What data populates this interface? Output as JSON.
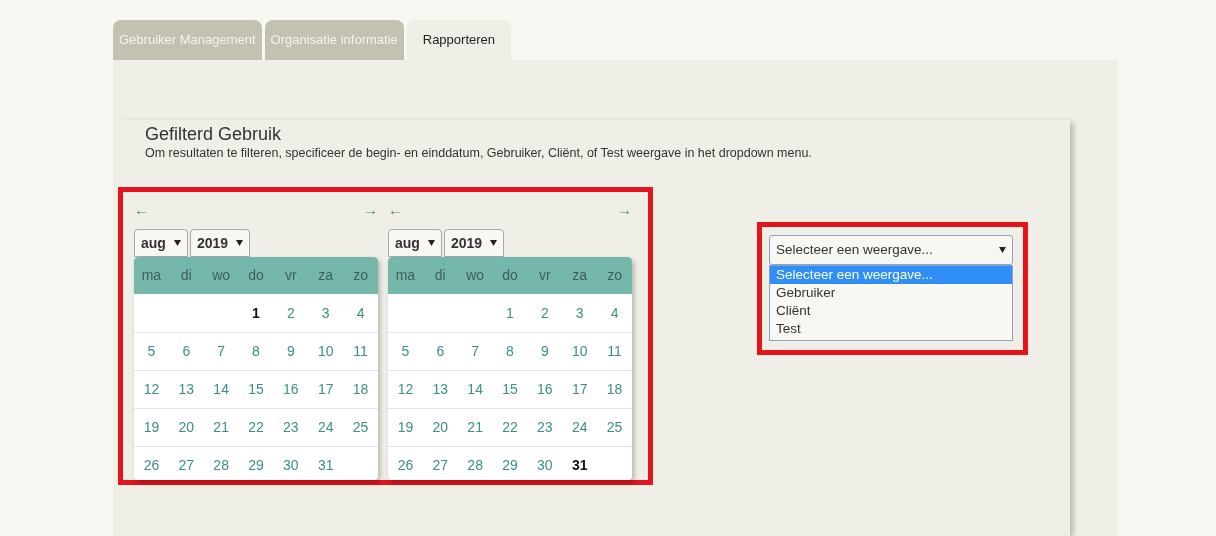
{
  "tabs": [
    {
      "label": "Gebruiker Management",
      "selected": false
    },
    {
      "label": "Organisatie informatie",
      "selected": false
    },
    {
      "label": "Rapporteren",
      "selected": true
    }
  ],
  "section": {
    "title": "Gefilterd Gebruik",
    "description": "Om resultaten te filteren, specificeer de begin- en einddatum, Gebruiker, Cliënt, of Test weergave in het dropdown menu."
  },
  "calendars": [
    {
      "prev": "←",
      "next": "→",
      "month": "aug",
      "year": "2019",
      "weekdays": [
        "ma",
        "di",
        "wo",
        "do",
        "vr",
        "za",
        "zo"
      ],
      "weeks": [
        [
          {
            "day": "1",
            "selected": true
          },
          {
            "day": "2",
            "selected": false
          },
          {
            "day": "3",
            "selected": false
          },
          {
            "day": "4",
            "selected": false
          }
        ],
        [
          {
            "day": "5",
            "selected": false
          },
          {
            "day": "6",
            "selected": false
          },
          {
            "day": "7",
            "selected": false
          },
          {
            "day": "8",
            "selected": false
          },
          {
            "day": "9",
            "selected": false
          },
          {
            "day": "10",
            "selected": false
          },
          {
            "day": "11",
            "selected": false
          }
        ],
        [
          {
            "day": "12",
            "selected": false
          },
          {
            "day": "13",
            "selected": false
          },
          {
            "day": "14",
            "selected": false
          },
          {
            "day": "15",
            "selected": false
          },
          {
            "day": "16",
            "selected": false
          },
          {
            "day": "17",
            "selected": false
          },
          {
            "day": "18",
            "selected": false
          }
        ],
        [
          {
            "day": "19",
            "selected": false
          },
          {
            "day": "20",
            "selected": false
          },
          {
            "day": "21",
            "selected": false
          },
          {
            "day": "22",
            "selected": false
          },
          {
            "day": "23",
            "selected": false
          },
          {
            "day": "24",
            "selected": false
          },
          {
            "day": "25",
            "selected": false
          }
        ],
        [
          {
            "day": "26",
            "selected": false
          },
          {
            "day": "27",
            "selected": false
          },
          {
            "day": "28",
            "selected": false
          },
          {
            "day": "29",
            "selected": false
          },
          {
            "day": "30",
            "selected": false
          },
          {
            "day": "31",
            "selected": false
          }
        ]
      ]
    },
    {
      "prev": "←",
      "next": "→",
      "month": "aug",
      "year": "2019",
      "weekdays": [
        "ma",
        "di",
        "wo",
        "do",
        "vr",
        "za",
        "zo"
      ],
      "weeks": [
        [
          {
            "day": "1",
            "selected": false
          },
          {
            "day": "2",
            "selected": false
          },
          {
            "day": "3",
            "selected": false
          },
          {
            "day": "4",
            "selected": false
          }
        ],
        [
          {
            "day": "5",
            "selected": false
          },
          {
            "day": "6",
            "selected": false
          },
          {
            "day": "7",
            "selected": false
          },
          {
            "day": "8",
            "selected": false
          },
          {
            "day": "9",
            "selected": false
          },
          {
            "day": "10",
            "selected": false
          },
          {
            "day": "11",
            "selected": false
          }
        ],
        [
          {
            "day": "12",
            "selected": false
          },
          {
            "day": "13",
            "selected": false
          },
          {
            "day": "14",
            "selected": false
          },
          {
            "day": "15",
            "selected": false
          },
          {
            "day": "16",
            "selected": false
          },
          {
            "day": "17",
            "selected": false
          },
          {
            "day": "18",
            "selected": false
          }
        ],
        [
          {
            "day": "19",
            "selected": false
          },
          {
            "day": "20",
            "selected": false
          },
          {
            "day": "21",
            "selected": false
          },
          {
            "day": "22",
            "selected": false
          },
          {
            "day": "23",
            "selected": false
          },
          {
            "day": "24",
            "selected": false
          },
          {
            "day": "25",
            "selected": false
          }
        ],
        [
          {
            "day": "26",
            "selected": false
          },
          {
            "day": "27",
            "selected": false
          },
          {
            "day": "28",
            "selected": false
          },
          {
            "day": "29",
            "selected": false
          },
          {
            "day": "30",
            "selected": false
          },
          {
            "day": "31",
            "selected": true
          }
        ]
      ]
    }
  ],
  "view_select": {
    "value": "Selecteer een weergave...",
    "options": [
      {
        "label": "Selecteer een weergave...",
        "selected": true
      },
      {
        "label": "Gebruiker",
        "selected": false
      },
      {
        "label": "Cliënt",
        "selected": false
      },
      {
        "label": "Test",
        "selected": false
      }
    ]
  }
}
